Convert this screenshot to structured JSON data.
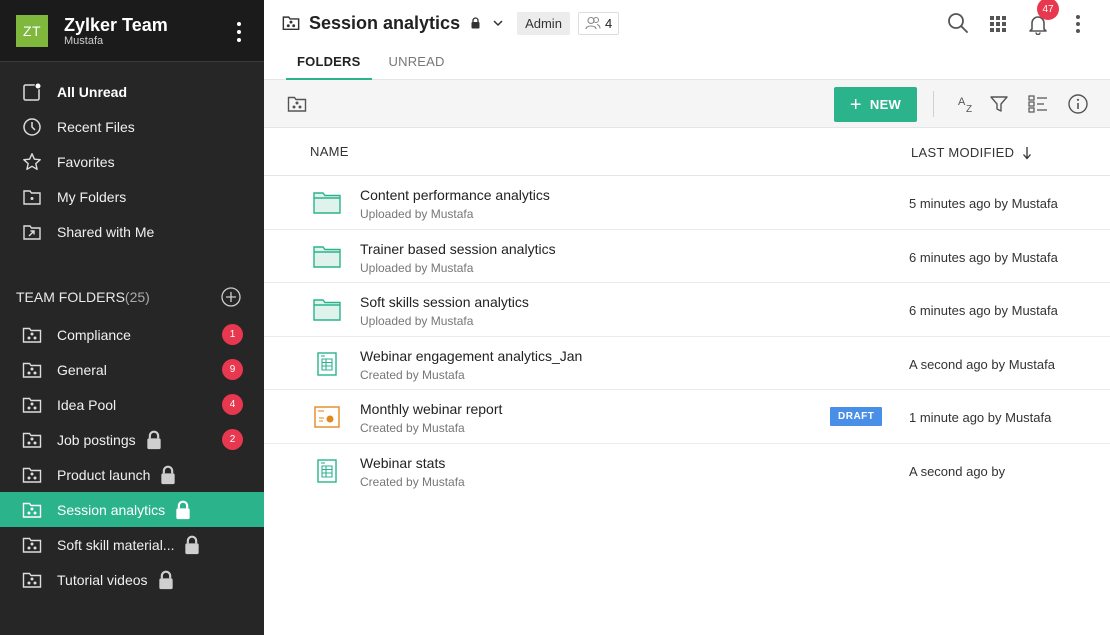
{
  "team": {
    "initials": "ZT",
    "name": "Zylker Team",
    "user": "Mustafa"
  },
  "nav": [
    {
      "label": "All Unread",
      "icon": "all-unread-icon"
    },
    {
      "label": "Recent Files",
      "icon": "clock-icon"
    },
    {
      "label": "Favorites",
      "icon": "star-icon"
    },
    {
      "label": "My Folders",
      "icon": "my-folder-icon"
    },
    {
      "label": "Shared with Me",
      "icon": "shared-folder-icon"
    }
  ],
  "team_folders": {
    "label": "TEAM FOLDERS",
    "count": "(25)",
    "items": [
      {
        "label": "Compliance",
        "badge": "1"
      },
      {
        "label": "General",
        "badge": "9"
      },
      {
        "label": "Idea Pool",
        "badge": "4"
      },
      {
        "label": "Job postings",
        "badge": "2",
        "locked": true
      },
      {
        "label": "Product launch",
        "locked": true
      },
      {
        "label": "Session analytics",
        "locked": true,
        "active": true
      },
      {
        "label": "Soft skill material...",
        "locked": true
      },
      {
        "label": "Tutorial videos",
        "locked": true
      }
    ]
  },
  "header": {
    "title": "Session analytics",
    "role": "Admin",
    "members": "4",
    "notifications": "47"
  },
  "tabs": [
    {
      "label": "FOLDERS"
    },
    {
      "label": "UNREAD"
    }
  ],
  "toolbar": {
    "new_label": "NEW"
  },
  "columns": {
    "name": "NAME",
    "modified": "LAST MODIFIED"
  },
  "files": [
    {
      "name": "Content performance analytics",
      "sub": "Uploaded by Mustafa",
      "modified": "5 minutes ago by Mustafa",
      "type": "folder"
    },
    {
      "name": "Trainer based session analytics",
      "sub": "Uploaded by Mustafa",
      "modified": "6 minutes ago by Mustafa",
      "type": "folder"
    },
    {
      "name": "Soft skills session analytics",
      "sub": "Uploaded by Mustafa",
      "modified": "6 minutes ago by Mustafa",
      "type": "folder"
    },
    {
      "name": "Webinar engagement analytics_Jan",
      "sub": "Created by Mustafa",
      "modified": "A second ago by Mustafa",
      "type": "spreadsheet"
    },
    {
      "name": "Monthly webinar report",
      "sub": "Created by Mustafa",
      "modified": "1 minute ago by Mustafa",
      "type": "presentation",
      "tag": "DRAFT"
    },
    {
      "name": "Webinar stats",
      "sub": "Created by Mustafa",
      "modified": "A second ago by",
      "type": "spreadsheet"
    }
  ],
  "colors": {
    "accent": "#2bb38c",
    "badge": "#e8384f",
    "draft": "#4a8fe7",
    "sidebar": "#262626",
    "avatar": "#7fb83d",
    "presentation": "#e08a1e"
  }
}
